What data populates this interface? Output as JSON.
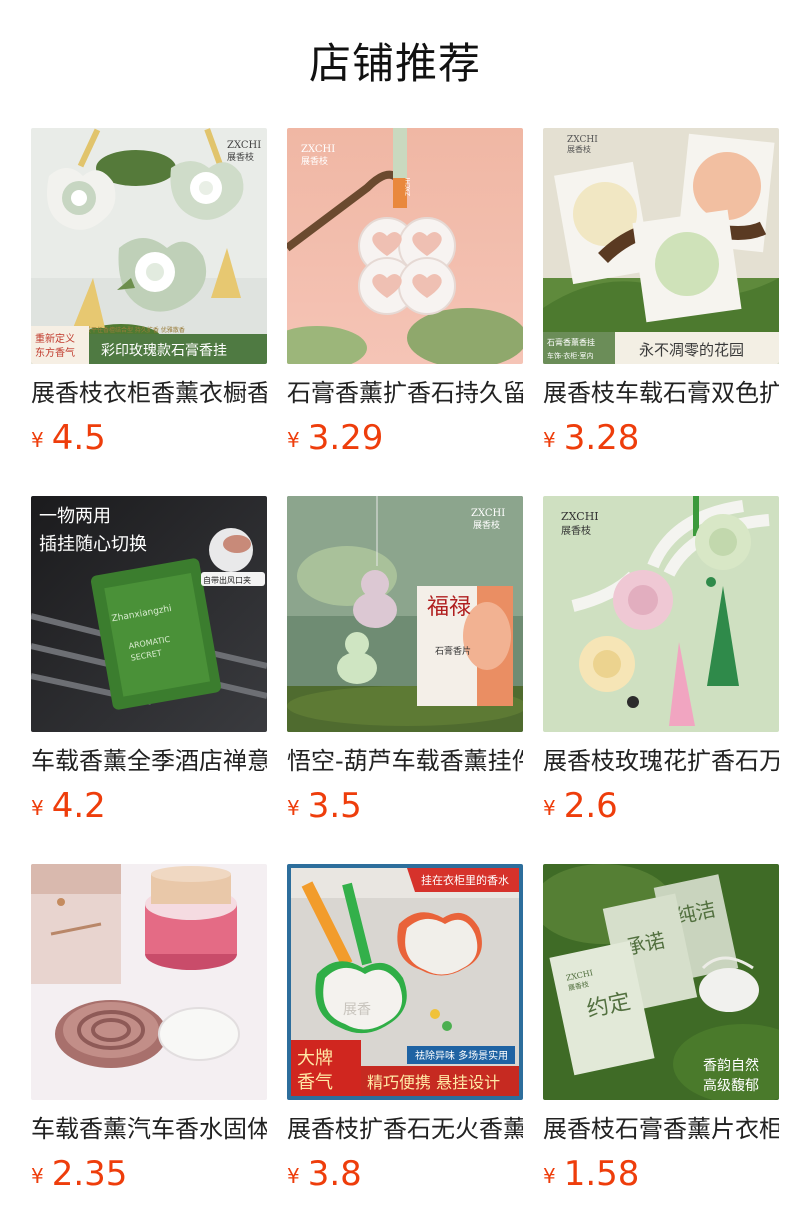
{
  "section_title": "店铺推荐",
  "colors": {
    "price": "#ee3d0b",
    "title": "#111111",
    "name": "#222222"
  },
  "products": [
    {
      "name": "展香枝衣柜香薰衣橱香片",
      "currency": "¥",
      "price": "4.5",
      "image": {
        "brand_en": "ZXCHI",
        "brand_cn": "展香枝",
        "badge_top": "重新定义",
        "badge_bottom": "东方香气",
        "fine_text": "持段平任香檀结合型 持久扩香 优雅散香",
        "banner": "彩印玫瑰款石膏香挂"
      }
    },
    {
      "name": "石膏香薰扩香石持久留香",
      "currency": "¥",
      "price": "3.29",
      "image": {
        "brand_en": "ZXCHI",
        "brand_cn": "展香枝",
        "ribbon_text": "ZXCHI"
      }
    },
    {
      "name": "展香枝车载石膏双色扩香片",
      "currency": "¥",
      "price": "3.28",
      "image": {
        "brand_en": "ZXCHI",
        "brand_cn": "展香枝",
        "tag_line1": "石膏香薰香挂",
        "tag_line2": "车饰·衣柜·室内",
        "caption": "永不凋零的花园"
      }
    },
    {
      "name": "车载香薰全季酒店禅意香包",
      "currency": "¥",
      "price": "4.2",
      "image": {
        "headline1": "一物两用",
        "headline2": "插挂随心切换",
        "clip_label": "自带出风口夹",
        "pack_brand": "Zhanxiangzhi",
        "pack_line1": "AROMATIC",
        "pack_line2": "SECRET"
      }
    },
    {
      "name": "悟空-葫芦车载香薰挂件",
      "currency": "¥",
      "price": "3.5",
      "image": {
        "brand_en": "ZXCHI",
        "brand_cn": "展香枝",
        "box_title": "福禄",
        "box_sub": "石膏香片"
      }
    },
    {
      "name": "展香枝玫瑰花扩香石万能",
      "currency": "¥",
      "price": "2.6",
      "image": {
        "brand_en": "ZXCHI",
        "brand_cn": "展香枝"
      }
    },
    {
      "name": "车载香薰汽车香水固体膏",
      "currency": "¥",
      "price": "2.35",
      "image": {}
    },
    {
      "name": "展香枝扩香石无火香薰挂件",
      "currency": "¥",
      "price": "3.8",
      "image": {
        "corner_tag": "挂在衣柜里的香水",
        "sub_tag": "祛除异味 多场景实用",
        "badge_line1": "大牌",
        "badge_line2": "香气",
        "banner": "精巧便携 悬挂设计",
        "plate_text": "展香"
      }
    },
    {
      "name": "展香枝石膏香薰片衣柜挂",
      "currency": "¥",
      "price": "1.58",
      "image": {
        "box1": "纯洁",
        "box2": "承诺",
        "box3": "约定",
        "box_brand_en": "ZXCHI",
        "box_brand_cn": "展香枝",
        "caption1": "香韵自然",
        "caption2": "高级馥郁"
      }
    }
  ]
}
